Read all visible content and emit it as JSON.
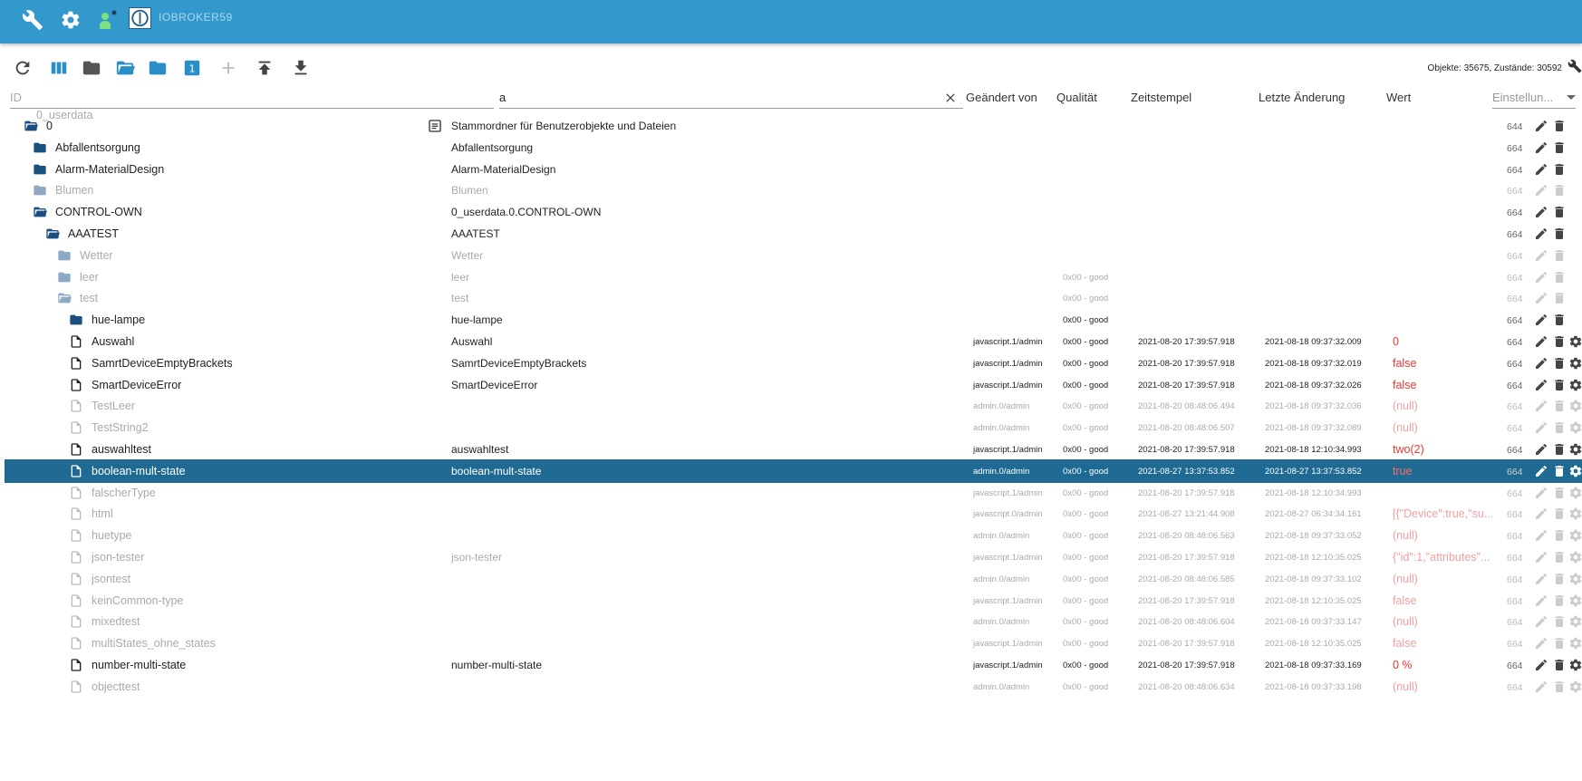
{
  "header": {
    "brand": "IOBROKER59",
    "icons": [
      "wrench-icon",
      "cog-icon",
      "user-icon"
    ]
  },
  "toolbar": {
    "counts": "Objekte: 35675, Zustände: 30592",
    "badge": "1",
    "icons": [
      "refresh-icon",
      "columns-icon",
      "folder-icon",
      "folder-open-icon",
      "folder-icon",
      "numbered-badge-icon",
      "add-icon",
      "upload-icon",
      "download-icon"
    ]
  },
  "filters": {
    "id_placeholder": "ID",
    "name_value": "a",
    "settings_placeholder": "Einstellun..."
  },
  "columns": {
    "changed_by": "Geändert von",
    "quality": "Qualität",
    "timestamp": "Zeitstempel",
    "last_change": "Letzte Änderung",
    "value": "Wert"
  },
  "partial_top": "0_userdata",
  "rows": [
    {
      "id": "0",
      "name": "Stammordner für Benutzerobjekte und Dateien",
      "type": "folder-open",
      "level": 1,
      "dim": false,
      "acl": "644",
      "from": "",
      "q": "",
      "ts": "",
      "lc": "",
      "val": "",
      "gear": false,
      "nameicon": true
    },
    {
      "id": "Abfallentsorgung",
      "name": "Abfallentsorgung",
      "type": "folder",
      "level": 2,
      "dim": false,
      "acl": "664",
      "from": "",
      "q": "",
      "ts": "",
      "lc": "",
      "val": "",
      "gear": false
    },
    {
      "id": "Alarm-MaterialDesign",
      "name": "Alarm-MaterialDesign",
      "type": "folder",
      "level": 2,
      "dim": false,
      "acl": "664",
      "from": "",
      "q": "",
      "ts": "",
      "lc": "",
      "val": "",
      "gear": false
    },
    {
      "id": "Blumen",
      "name": "Blumen",
      "type": "folder",
      "level": 2,
      "dim": true,
      "acl": "664",
      "from": "",
      "q": "",
      "ts": "",
      "lc": "",
      "val": "",
      "gear": false
    },
    {
      "id": "CONTROL-OWN",
      "name": "0_userdata.0.CONTROL-OWN",
      "type": "folder-open",
      "level": 2,
      "dim": false,
      "acl": "664",
      "from": "",
      "q": "",
      "ts": "",
      "lc": "",
      "val": "",
      "gear": false
    },
    {
      "id": "AAATEST",
      "name": "AAATEST",
      "type": "folder-open",
      "level": 3,
      "dim": false,
      "acl": "664",
      "from": "",
      "q": "",
      "ts": "",
      "lc": "",
      "val": "",
      "gear": false
    },
    {
      "id": "Wetter",
      "name": "Wetter",
      "type": "folder",
      "level": 4,
      "dim": true,
      "acl": "664",
      "from": "",
      "q": "",
      "ts": "",
      "lc": "",
      "val": "",
      "gear": false
    },
    {
      "id": "leer",
      "name": "leer",
      "type": "folder",
      "level": 4,
      "dim": true,
      "acl": "664",
      "from": "",
      "q": "0x00 - good",
      "ts": "",
      "lc": "",
      "val": "",
      "gear": false
    },
    {
      "id": "test",
      "name": "test",
      "type": "folder-open",
      "level": 4,
      "dim": true,
      "acl": "664",
      "from": "",
      "q": "0x00 - good",
      "ts": "",
      "lc": "",
      "val": "",
      "gear": false
    },
    {
      "id": "hue-lampe",
      "name": "hue-lampe",
      "type": "folder",
      "level": 5,
      "dim": false,
      "acl": "664",
      "from": "",
      "q": "0x00 - good",
      "ts": "",
      "lc": "",
      "val": "",
      "gear": false
    },
    {
      "id": "Auswahl",
      "name": "Auswahl",
      "type": "file",
      "level": 5,
      "dim": false,
      "acl": "664",
      "from": "javascript.1/admin",
      "q": "0x00 - good",
      "ts": "2021-08-20 17:39:57.918",
      "lc": "2021-08-18 09:37:32.009",
      "val": "0",
      "gear": true
    },
    {
      "id": "SamrtDeviceEmptyBrackets",
      "name": "SamrtDeviceEmptyBrackets",
      "type": "file",
      "level": 5,
      "dim": false,
      "acl": "664",
      "from": "javascript.1/admin",
      "q": "0x00 - good",
      "ts": "2021-08-20 17:39:57.918",
      "lc": "2021-08-18 09:37:32.019",
      "val": "false",
      "gear": true
    },
    {
      "id": "SmartDeviceError",
      "name": "SmartDeviceError",
      "type": "file",
      "level": 5,
      "dim": false,
      "acl": "664",
      "from": "javascript.1/admin",
      "q": "0x00 - good",
      "ts": "2021-08-20 17:39:57.918",
      "lc": "2021-08-18 09:37:32.026",
      "val": "false",
      "gear": true
    },
    {
      "id": "TestLeer",
      "name": "",
      "type": "file",
      "level": 5,
      "dim": true,
      "acl": "664",
      "from": "admin.0/admin",
      "q": "0x00 - good",
      "ts": "2021-08-20 08:48:06.494",
      "lc": "2021-08-18 09:37:32.036",
      "val": "(null)",
      "gear": true
    },
    {
      "id": "TestString2",
      "name": "",
      "type": "file",
      "level": 5,
      "dim": true,
      "acl": "664",
      "from": "admin.0/admin",
      "q": "0x00 - good",
      "ts": "2021-08-20 08:48:06.507",
      "lc": "2021-08-18 09:37:32.089",
      "val": "(null)",
      "gear": true
    },
    {
      "id": "auswahltest",
      "name": "auswahltest",
      "type": "file",
      "level": 5,
      "dim": false,
      "acl": "664",
      "from": "javascript.1/admin",
      "q": "0x00 - good",
      "ts": "2021-08-20 17:39:57.918",
      "lc": "2021-08-18 12:10:34.993",
      "val": "two(2)",
      "gear": true
    },
    {
      "id": "boolean-mult-state",
      "name": "boolean-mult-state",
      "type": "file",
      "level": 5,
      "dim": false,
      "selected": true,
      "acl": "664",
      "from": "admin.0/admin",
      "q": "0x00 - good",
      "ts": "2021-08-27 13:37:53.852",
      "lc": "2021-08-27 13:37:53.852",
      "val": "true",
      "gear": true
    },
    {
      "id": "falscherType",
      "name": "",
      "type": "file",
      "level": 5,
      "dim": true,
      "acl": "664",
      "from": "javascript.1/admin",
      "q": "0x00 - good",
      "ts": "2021-08-20 17:39:57.918",
      "lc": "2021-08-18 12:10:34.993",
      "val": "",
      "gear": true
    },
    {
      "id": "html",
      "name": "",
      "type": "file",
      "level": 5,
      "dim": true,
      "acl": "664",
      "from": "javascript.0/admin",
      "q": "0x00 - good",
      "ts": "2021-08-27 13:21:44.908",
      "lc": "2021-08-27 06:34:34.161",
      "val": "[{\"Device\":true,\"su...",
      "gear": true
    },
    {
      "id": "huetype",
      "name": "",
      "type": "file",
      "level": 5,
      "dim": true,
      "acl": "664",
      "from": "admin.0/admin",
      "q": "0x00 - good",
      "ts": "2021-08-20 08:48:06.563",
      "lc": "2021-08-18 09:37:33.052",
      "val": "(null)",
      "gear": true
    },
    {
      "id": "json-tester",
      "name": "json-tester",
      "type": "file",
      "level": 5,
      "dim": true,
      "acl": "664",
      "from": "javascript.1/admin",
      "q": "0x00 - good",
      "ts": "2021-08-20 17:39:57.918",
      "lc": "2021-08-18 12:10:35.025",
      "val": "{\"id\":1,\"attributes\"...",
      "gear": true
    },
    {
      "id": "jsontest",
      "name": "",
      "type": "file",
      "level": 5,
      "dim": true,
      "acl": "664",
      "from": "admin.0/admin",
      "q": "0x00 - good",
      "ts": "2021-08-20 08:48:06.585",
      "lc": "2021-08-18 09:37:33.102",
      "val": "(null)",
      "gear": true
    },
    {
      "id": "keinCommon-type",
      "name": "",
      "type": "file",
      "level": 5,
      "dim": true,
      "acl": "664",
      "from": "javascript.1/admin",
      "q": "0x00 - good",
      "ts": "2021-08-20 17:39:57.918",
      "lc": "2021-08-18 12:10:35.025",
      "val": "false",
      "gear": true
    },
    {
      "id": "mixedtest",
      "name": "",
      "type": "file",
      "level": 5,
      "dim": true,
      "acl": "664",
      "from": "admin.0/admin",
      "q": "0x00 - good",
      "ts": "2021-08-20 08:48:06.604",
      "lc": "2021-08-18 09:37:33.147",
      "val": "(null)",
      "gear": true
    },
    {
      "id": "multiStates_ohne_states",
      "name": "",
      "type": "file",
      "level": 5,
      "dim": true,
      "acl": "664",
      "from": "javascript.1/admin",
      "q": "0x00 - good",
      "ts": "2021-08-20 17:39:57.918",
      "lc": "2021-08-18 12:10:35.025",
      "val": "false",
      "gear": true
    },
    {
      "id": "number-multi-state",
      "name": "number-multi-state",
      "type": "file",
      "level": 5,
      "dim": false,
      "acl": "664",
      "from": "javascript.1/admin",
      "q": "0x00 - good",
      "ts": "2021-08-20 17:39:57.918",
      "lc": "2021-08-18 09:37:33.169",
      "val": "0 %",
      "gear": true
    },
    {
      "id": "objecttest",
      "name": "",
      "type": "file",
      "level": 5,
      "dim": true,
      "acl": "664",
      "from": "admin.0/admin",
      "q": "0x00 - good",
      "ts": "2021-08-20 08:48:06.634",
      "lc": "2021-08-18 09:37:33.198",
      "val": "(null)",
      "gear": true
    }
  ],
  "colors": {
    "header_bg": "#3399cc",
    "toolbar_blue": "#2a8fc9",
    "folder_dark": "#1a4f80",
    "folder_dim": "#8fa8c4",
    "selected_row": "#1f6a93",
    "value_red": "#e53935"
  }
}
